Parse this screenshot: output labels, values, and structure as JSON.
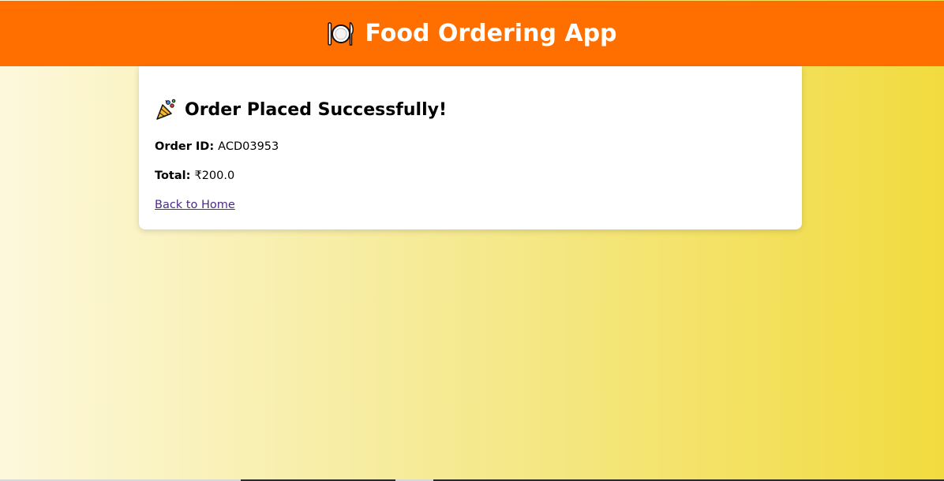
{
  "header": {
    "icon": "plate-with-cutlery-icon",
    "title": "Food Ordering App",
    "background_color": "#ff6f00"
  },
  "confirmation": {
    "icon": "party-popper-icon",
    "heading": "Order Placed Successfully!",
    "order_id_label": "Order ID:",
    "order_id_value": "ACD03953",
    "total_label": "Total:",
    "total_value": "₹200.0",
    "back_link": "Back to Home",
    "link_color": "#4b2a8a"
  },
  "page": {
    "background_start": "#fdf8dc",
    "background_end": "#f2db3f"
  }
}
